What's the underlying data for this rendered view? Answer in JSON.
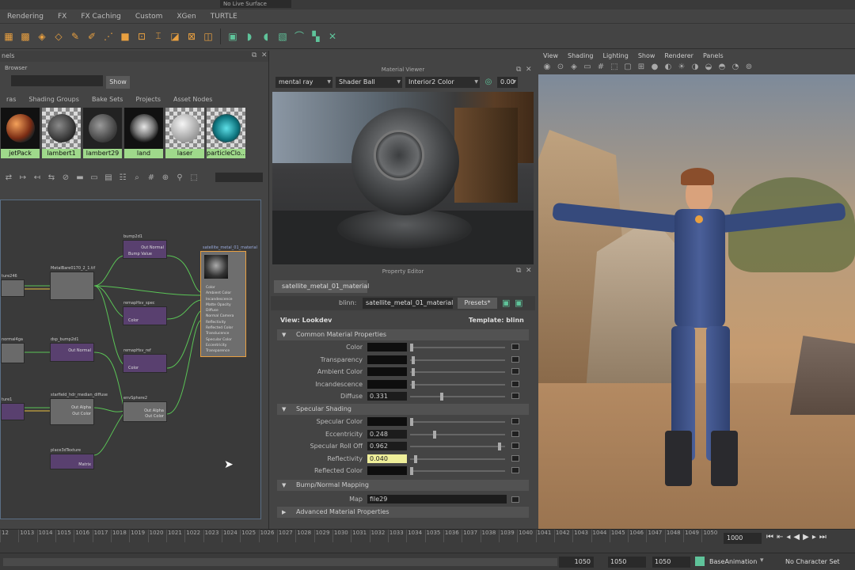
{
  "top": {
    "live_surface": "No Live Surface"
  },
  "menu_tabs": [
    "Rendering",
    "FX",
    "FX Caching",
    "Custom",
    "XGen",
    "TURTLE"
  ],
  "hypershade": {
    "panel_title": "nels",
    "browser_title": "Browser",
    "show_button": "Show",
    "tabs": [
      "ras",
      "Shading Groups",
      "Bake Sets",
      "Projects",
      "Asset Nodes"
    ],
    "materials": [
      "jetPack",
      "lambert1",
      "lambert29",
      "land",
      "laser",
      "particleClo..."
    ],
    "nodes": {
      "bump2d1": "bump2d1",
      "bump2d1_out": "Out Normal",
      "bump2d1_in": "Bump Value",
      "metal_file": "MetalBare0170_2_1.tif",
      "remap_spec": "remapHsv_spec",
      "remap_spec_port": "Color",
      "remap_ref": "remapHsv_ref",
      "remap_ref_port": "Color",
      "dsp_bump": "dsp_bump2d1",
      "starfield": "starfield_hdr_median_diffuse",
      "envSphere": "envSphere2",
      "place3d": "place3dTexture",
      "place3d_port": "Matrix",
      "normal": "normal4ga",
      "file246": "ture246",
      "file1": "ture1",
      "out_alpha": "Out Alpha",
      "out_color": "Out Color",
      "material": "satellite_metal_01_material",
      "mat_ports": [
        "Color",
        "Ambient Color",
        "Incandescence",
        "Matte Opacity",
        "Diffuse",
        "Normal Camera",
        "Reflectivity",
        "Reflected Color",
        "Translucence",
        "Specular Color",
        "Eccentricity",
        "Transparence"
      ]
    }
  },
  "material_viewer": {
    "title": "Material Viewer",
    "renderer": "mental ray",
    "shape": "Shader Ball",
    "environment": "Interior2 Color",
    "exposure": "0.00"
  },
  "property_editor": {
    "title": "Property Editor",
    "tab": "satellite_metal_01_material",
    "node_type": "blinn:",
    "node_name": "satellite_metal_01_material",
    "presets": "Presets*",
    "view_label": "View: Lookdev",
    "template_label": "Template: blinn",
    "common_section": "Common Material Properties",
    "common": [
      {
        "label": "Color",
        "value": "",
        "kind": "swatch",
        "knob": 0
      },
      {
        "label": "Transparency",
        "value": "",
        "kind": "swatch",
        "knob": 0.02
      },
      {
        "label": "Ambient Color",
        "value": "",
        "kind": "swatch",
        "knob": 0.02
      },
      {
        "label": "Incandescence",
        "value": "",
        "kind": "swatch",
        "knob": 0.02
      },
      {
        "label": "Diffuse",
        "value": "0.331",
        "kind": "num",
        "knob": 0.33
      }
    ],
    "spec_section": "Specular Shading",
    "specular": [
      {
        "label": "Specular Color",
        "value": "",
        "kind": "swatch",
        "knob": 0
      },
      {
        "label": "Eccentricity",
        "value": "0.248",
        "kind": "num",
        "knob": 0.25
      },
      {
        "label": "Specular Roll Off",
        "value": "0.962",
        "kind": "num",
        "knob": 0.96
      },
      {
        "label": "Reflectivity",
        "value": "0.040",
        "kind": "hi",
        "knob": 0.04
      },
      {
        "label": "Reflected Color",
        "value": "",
        "kind": "swatch",
        "knob": 0
      }
    ],
    "bump_section": "Bump/Normal Mapping",
    "map_label": "Map",
    "map_value": "file29",
    "advanced_section": "Advanced Material Properties"
  },
  "viewport": {
    "menus": [
      "View",
      "Shading",
      "Lighting",
      "Show",
      "Renderer",
      "Panels"
    ]
  },
  "timeline": {
    "ticks": [
      "12",
      "1013",
      "1014",
      "1015",
      "1016",
      "1017",
      "1018",
      "1019",
      "1020",
      "1021",
      "1022",
      "1023",
      "1024",
      "1025",
      "1026",
      "1027",
      "1028",
      "1029",
      "1030",
      "1031",
      "1032",
      "1033",
      "1034",
      "1035",
      "1036",
      "1037",
      "1038",
      "1039",
      "1040",
      "1041",
      "1042",
      "1043",
      "1044",
      "1045",
      "1046",
      "1047",
      "1048",
      "1049",
      "1050"
    ],
    "current_frame": "1000",
    "range_end_a": "1050",
    "range_end_b": "1050",
    "range_end_c": "1050",
    "anim_layer": "BaseAnimation",
    "char_set": "No Character Set"
  }
}
